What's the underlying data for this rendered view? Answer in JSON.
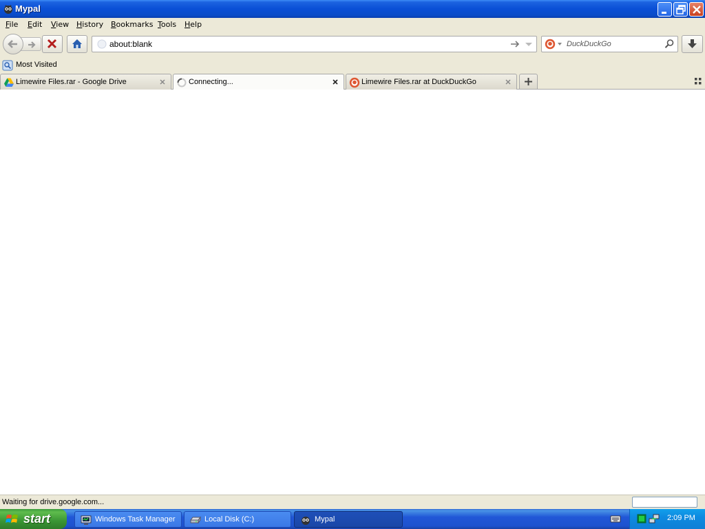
{
  "window": {
    "title": "Mypal"
  },
  "menu": {
    "items": [
      {
        "label": "File",
        "key": "F",
        "rest": "ile"
      },
      {
        "label": "Edit",
        "key": "E",
        "rest": "dit"
      },
      {
        "label": "View",
        "key": "V",
        "rest": "iew"
      },
      {
        "label": "History",
        "key": "H",
        "rest": "istory"
      },
      {
        "label": "Bookmarks",
        "key": "B",
        "rest": "ookmarks"
      },
      {
        "label": "Tools",
        "key": "T",
        "rest": "ools"
      },
      {
        "label": "Help",
        "key": "H",
        "rest": "elp"
      }
    ]
  },
  "navbar": {
    "url": "about:blank",
    "search_placeholder": "DuckDuckGo"
  },
  "bookmarks": {
    "most_visited": "Most Visited"
  },
  "tabs": [
    {
      "label": "Limewire Files.rar - Google Drive",
      "icon": "google-drive-icon",
      "selected": false
    },
    {
      "label": "Connecting...",
      "icon": "loading-spinner-icon",
      "selected": true
    },
    {
      "label": "Limewire Files.rar at DuckDuckGo",
      "icon": "duckduckgo-icon",
      "selected": false
    }
  ],
  "status": {
    "text": "Waiting for drive.google.com..."
  },
  "taskbar": {
    "start_label": "start",
    "tasks": [
      {
        "label": "Windows Task Manager",
        "icon": "task-manager-icon",
        "active": false
      },
      {
        "label": "Local Disk (C:)",
        "icon": "drive-icon",
        "active": false
      },
      {
        "label": "Mypal",
        "icon": "mypal-icon",
        "active": true
      }
    ],
    "clock": "2:09 PM"
  },
  "colors": {
    "titlebar_blue": "#0a4fd6",
    "chrome_beige": "#ece9d8",
    "taskbar_blue": "#2157d7",
    "start_green": "#3a9534",
    "tray_blue": "#0d8ae0"
  }
}
